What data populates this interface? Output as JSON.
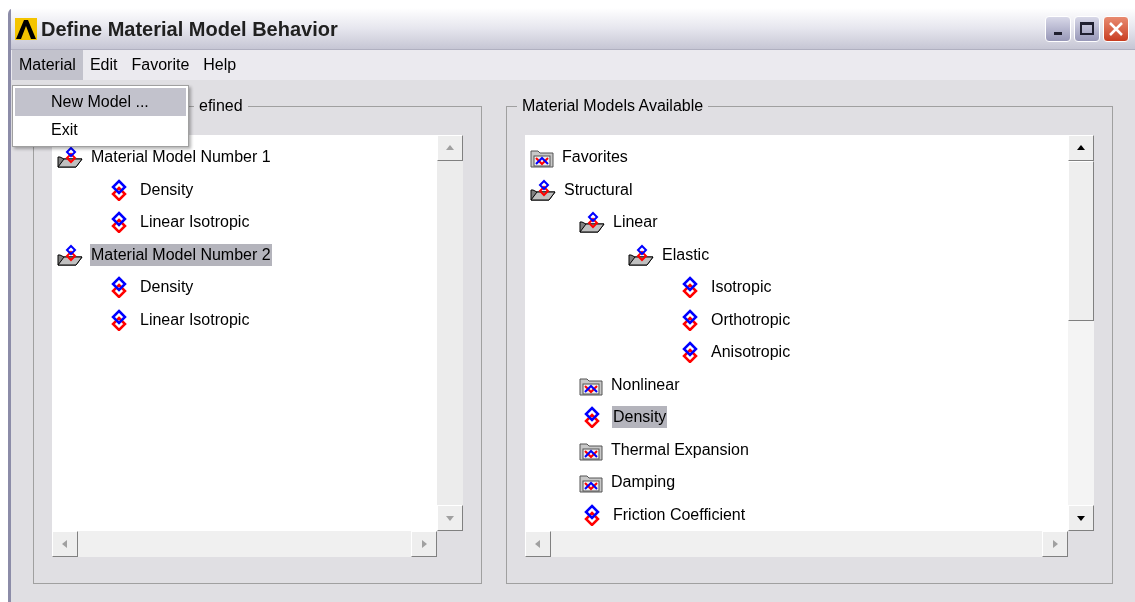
{
  "window": {
    "title": "Define Material Model Behavior"
  },
  "menu_bar": [
    {
      "label": "Material",
      "selected": true
    },
    {
      "label": "Edit",
      "selected": false
    },
    {
      "label": "Favorite",
      "selected": false
    },
    {
      "label": "Help",
      "selected": false
    }
  ],
  "dropdown": [
    {
      "label": "New Model ...",
      "selected": true
    },
    {
      "label": "Exit",
      "selected": false
    }
  ],
  "left_panel": {
    "title": "efined",
    "scrollbar_enabled": false,
    "tree": [
      {
        "label": "Material Model Number 1",
        "kind": "folder_open",
        "selected": false,
        "children": [
          {
            "label": "Density",
            "kind": "leaf",
            "selected": false
          },
          {
            "label": "Linear Isotropic",
            "kind": "leaf",
            "selected": false
          }
        ]
      },
      {
        "label": "Material Model Number 2",
        "kind": "folder_open",
        "selected": true,
        "children": [
          {
            "label": "Density",
            "kind": "leaf",
            "selected": false
          },
          {
            "label": "Linear Isotropic",
            "kind": "leaf",
            "selected": false
          }
        ]
      }
    ]
  },
  "right_panel": {
    "title": "Material Models Available",
    "scrollbar_enabled": true,
    "tree": [
      {
        "label": "Favorites",
        "kind": "folder_closed",
        "selected": false
      },
      {
        "label": "Structural",
        "kind": "folder_open",
        "selected": false,
        "children": [
          {
            "label": "Linear",
            "kind": "folder_open",
            "selected": false,
            "children": [
              {
                "label": "Elastic",
                "kind": "folder_open",
                "selected": false,
                "children": [
                  {
                    "label": "Isotropic",
                    "kind": "leaf",
                    "selected": false
                  },
                  {
                    "label": "Orthotropic",
                    "kind": "leaf",
                    "selected": false
                  },
                  {
                    "label": "Anisotropic",
                    "kind": "leaf",
                    "selected": false
                  }
                ]
              }
            ]
          },
          {
            "label": "Nonlinear",
            "kind": "folder_closed",
            "selected": false
          },
          {
            "label": "Density",
            "kind": "leaf",
            "selected": true
          },
          {
            "label": "Thermal Expansion",
            "kind": "folder_closed",
            "selected": false
          },
          {
            "label": "Damping",
            "kind": "folder_closed",
            "selected": false
          },
          {
            "label": "Friction Coefficient",
            "kind": "leaf",
            "selected": false
          }
        ]
      }
    ]
  }
}
